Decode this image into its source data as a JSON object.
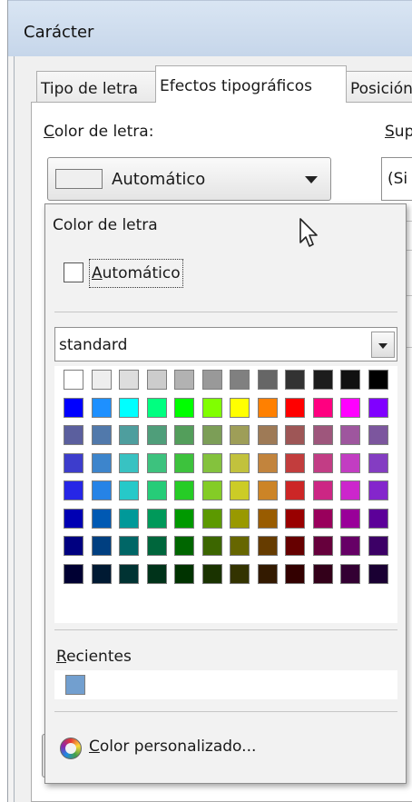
{
  "window": {
    "title": "Carácter"
  },
  "tabs": [
    {
      "label": "Tipo de letra",
      "active": false
    },
    {
      "label": "Efectos tipográficos",
      "active": true
    },
    {
      "label": "Posición",
      "active": false
    }
  ],
  "font_color": {
    "label_first": "C",
    "label_rest": "olor de letra:",
    "dropdown_value": "Automático"
  },
  "right_column": {
    "label_first": "S",
    "label_rest": "up",
    "field_value": "(Si"
  },
  "popup": {
    "header": "Color de letra",
    "auto_checkbox_first": "A",
    "auto_checkbox_rest": "utomático",
    "auto_checked": false,
    "palette_name": "standard",
    "recent_label_first": "R",
    "recent_label_rest": "ecientes",
    "recent_colors": [
      "#729fcf"
    ],
    "custom_color_first": "C",
    "custom_color_rest": "olor personalizado..."
  },
  "palette": [
    "#ffffff",
    "#eeeeee",
    "#dddddd",
    "#cccccc",
    "#b2b2b2",
    "#999999",
    "#808080",
    "#666666",
    "#333333",
    "#1c1c1c",
    "#111111",
    "#000000",
    "#0000ff",
    "#1e90ff",
    "#00ffff",
    "#00ff80",
    "#00ff00",
    "#80ff00",
    "#ffff00",
    "#ff8000",
    "#ff0000",
    "#ff0080",
    "#ff00ff",
    "#8000ff",
    "#5b5f9e",
    "#5179ab",
    "#4e9e9e",
    "#4f9e7a",
    "#539e5b",
    "#7c9e57",
    "#9e9e58",
    "#9e7a56",
    "#9e5656",
    "#9e567c",
    "#9e569e",
    "#7c569e",
    "#3d3dcc",
    "#3d85cc",
    "#38c2c2",
    "#3dc27e",
    "#3dc23d",
    "#84c23d",
    "#c2c23d",
    "#c2843d",
    "#c23d3d",
    "#c23d85",
    "#c23dc2",
    "#843dc2",
    "#2626e6",
    "#2683e6",
    "#26c9c9",
    "#26cc78",
    "#26cc26",
    "#84cc26",
    "#cccc26",
    "#cc8426",
    "#cc2626",
    "#cc2684",
    "#cc26cc",
    "#8426cc",
    "#0000b3",
    "#0059b3",
    "#009999",
    "#00995a",
    "#009900",
    "#5c9900",
    "#999900",
    "#995c00",
    "#990000",
    "#99005c",
    "#990099",
    "#5c0099",
    "#000080",
    "#003f80",
    "#006666",
    "#00663c",
    "#006600",
    "#3c6600",
    "#666600",
    "#663c00",
    "#660000",
    "#66003c",
    "#660066",
    "#3c0066",
    "#000033",
    "#001a33",
    "#003333",
    "#00331a",
    "#003300",
    "#1a3300",
    "#333300",
    "#331a00",
    "#330000",
    "#33001a",
    "#330033",
    "#1a0033"
  ]
}
